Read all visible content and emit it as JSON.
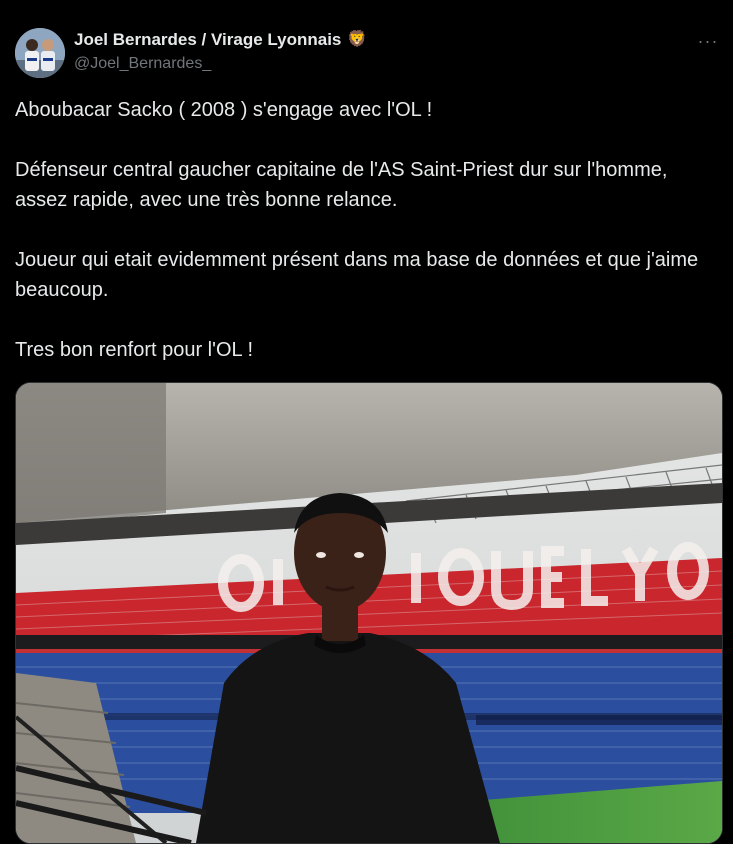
{
  "author": {
    "name": "Joel Bernardes / Virage Lyonnais",
    "emoji": "🦁",
    "handle": "@Joel_Bernardes_"
  },
  "menu": {
    "more_icon": "more-horizontal-icon",
    "more_glyph": "···"
  },
  "tweet": {
    "paragraphs": [
      "Aboubacar Sacko ( 2008 ) s'engage avec l'OL !",
      "Défenseur central gaucher capitaine de l'AS Saint-Priest dur sur l'homme, assez rapide, avec une très bonne relance.",
      "Joueur qui etait evidemment présent dans ma base de données et que j'aime beaucoup.",
      "Tres bon renfort pour l'OL !"
    ]
  },
  "media": {
    "stand_lettering": "OLYMPIQUE LYONNAIS"
  },
  "colors": {
    "background": "#000000",
    "text_primary": "#e7e9ea",
    "text_secondary": "#71767b",
    "seat_red": "#d42a30",
    "seat_blue": "#2b4f9e"
  }
}
